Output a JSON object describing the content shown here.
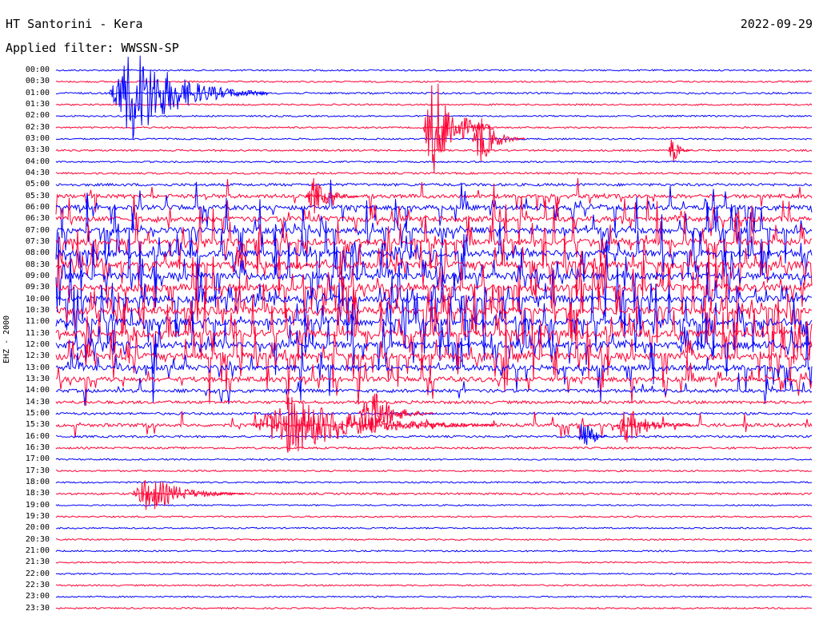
{
  "header": {
    "station": "HT Santorini - Kera",
    "filter": "Applied filter: WWSSN-SP",
    "date": "2022-09-29",
    "channel": "EHZ - 2000"
  },
  "colors": {
    "blue": "#0000ff",
    "red": "#ff0033"
  },
  "chart_data": {
    "type": "line",
    "title": "HT Santorini - Kera",
    "traces": [
      {
        "time": "00:00",
        "color": "blue",
        "activity": 0.05
      },
      {
        "time": "00:30",
        "color": "red",
        "activity": 0.05
      },
      {
        "time": "01:00",
        "color": "blue",
        "activity": 0.1
      },
      {
        "time": "01:30",
        "color": "red",
        "activity": 0.05
      },
      {
        "time": "02:00",
        "color": "blue",
        "activity": 0.05
      },
      {
        "time": "02:30",
        "color": "red",
        "activity": 0.05
      },
      {
        "time": "03:00",
        "color": "blue",
        "activity": 0.05
      },
      {
        "time": "03:30",
        "color": "red",
        "activity": 0.08
      },
      {
        "time": "04:00",
        "color": "blue",
        "activity": 0.05
      },
      {
        "time": "04:30",
        "color": "red",
        "activity": 0.1
      },
      {
        "time": "05:00",
        "color": "blue",
        "activity": 0.25
      },
      {
        "time": "05:30",
        "color": "red",
        "activity": 0.45
      },
      {
        "time": "06:00",
        "color": "blue",
        "activity": 0.6
      },
      {
        "time": "06:30",
        "color": "red",
        "activity": 0.7
      },
      {
        "time": "07:00",
        "color": "blue",
        "activity": 0.85
      },
      {
        "time": "07:30",
        "color": "red",
        "activity": 0.9
      },
      {
        "time": "08:00",
        "color": "blue",
        "activity": 0.95
      },
      {
        "time": "08:30",
        "color": "red",
        "activity": 1.0
      },
      {
        "time": "09:00",
        "color": "blue",
        "activity": 1.0
      },
      {
        "time": "09:30",
        "color": "red",
        "activity": 1.0
      },
      {
        "time": "10:00",
        "color": "blue",
        "activity": 1.0
      },
      {
        "time": "10:30",
        "color": "red",
        "activity": 1.0
      },
      {
        "time": "11:00",
        "color": "blue",
        "activity": 1.0
      },
      {
        "time": "11:30",
        "color": "red",
        "activity": 1.0
      },
      {
        "time": "12:00",
        "color": "blue",
        "activity": 1.0
      },
      {
        "time": "12:30",
        "color": "red",
        "activity": 1.0
      },
      {
        "time": "13:00",
        "color": "blue",
        "activity": 0.8
      },
      {
        "time": "13:30",
        "color": "red",
        "activity": 0.6
      },
      {
        "time": "14:00",
        "color": "blue",
        "activity": 0.35
      },
      {
        "time": "14:30",
        "color": "red",
        "activity": 0.3
      },
      {
        "time": "15:00",
        "color": "blue",
        "activity": 0.2
      },
      {
        "time": "15:30",
        "color": "red",
        "activity": 0.35
      },
      {
        "time": "16:00",
        "color": "blue",
        "activity": 0.15
      },
      {
        "time": "16:30",
        "color": "red",
        "activity": 0.12
      },
      {
        "time": "17:00",
        "color": "blue",
        "activity": 0.06
      },
      {
        "time": "17:30",
        "color": "red",
        "activity": 0.06
      },
      {
        "time": "18:00",
        "color": "blue",
        "activity": 0.05
      },
      {
        "time": "18:30",
        "color": "red",
        "activity": 0.12
      },
      {
        "time": "19:00",
        "color": "blue",
        "activity": 0.03
      },
      {
        "time": "19:30",
        "color": "red",
        "activity": 0.04
      },
      {
        "time": "20:00",
        "color": "blue",
        "activity": 0.03
      },
      {
        "time": "20:30",
        "color": "red",
        "activity": 0.03
      },
      {
        "time": "21:00",
        "color": "blue",
        "activity": 0.04
      },
      {
        "time": "21:30",
        "color": "red",
        "activity": 0.03
      },
      {
        "time": "22:00",
        "color": "blue",
        "activity": 0.03
      },
      {
        "time": "22:30",
        "color": "red",
        "activity": 0.05
      },
      {
        "time": "23:00",
        "color": "blue",
        "activity": 0.03
      },
      {
        "time": "23:30",
        "color": "red",
        "activity": 0.03
      }
    ],
    "events": [
      {
        "trace": 2,
        "start": 0.07,
        "end": 0.28,
        "amplitude": 0.9,
        "color": "blue"
      },
      {
        "trace": 5,
        "start": 0.485,
        "end": 0.58,
        "amplitude": 1.0,
        "color": "red"
      },
      {
        "trace": 6,
        "start": 0.55,
        "end": 0.62,
        "amplitude": 0.5,
        "color": "red"
      },
      {
        "trace": 7,
        "start": 0.81,
        "end": 0.84,
        "amplitude": 0.3,
        "color": "red"
      },
      {
        "trace": 11,
        "start": 0.33,
        "end": 0.4,
        "amplitude": 0.35,
        "color": "red"
      },
      {
        "trace": 30,
        "start": 0.4,
        "end": 0.5,
        "amplitude": 0.5,
        "color": "red"
      },
      {
        "trace": 31,
        "start": 0.26,
        "end": 0.58,
        "amplitude": 0.55,
        "color": "red"
      },
      {
        "trace": 31,
        "start": 0.74,
        "end": 0.84,
        "amplitude": 0.35,
        "color": "red"
      },
      {
        "trace": 32,
        "start": 0.69,
        "end": 0.73,
        "amplitude": 0.45,
        "color": "blue"
      },
      {
        "trace": 37,
        "start": 0.1,
        "end": 0.25,
        "amplitude": 0.35,
        "color": "red"
      }
    ]
  }
}
